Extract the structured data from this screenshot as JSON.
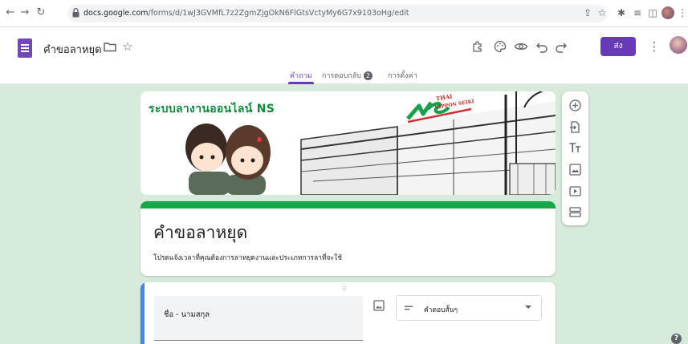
{
  "browser": {
    "url_host": "docs.google.com",
    "url_path": "/forms/d/1wJ3GVMfL7z2ZgmZjgOkN6FlGtsVctyMy6G7x9103oHg/edit"
  },
  "forms_header": {
    "doc_title": "คำขอลาหยุด",
    "send_label": "ส่ง"
  },
  "tabs": {
    "items": [
      {
        "label": "คำถาม",
        "active": true
      },
      {
        "label": "การตอบกลับ",
        "badge": "2"
      },
      {
        "label": "การตั้งค่า"
      }
    ]
  },
  "banner": {
    "title": "ระบบลางานออนไลน์ NS",
    "logo_line1": "THAI",
    "logo_line2": "NIPPON SEIKI"
  },
  "form": {
    "title": "คำขอลาหยุด",
    "description": "โปรดแจ้งเวลาที่คุณต้องการลาหยุดงานและประเภทการลาที่จะใช้"
  },
  "question": {
    "text": "ชื่อ - นามสกุล",
    "type_label": "คำตอบสั้นๆ"
  },
  "colors": {
    "theme_accent": "#14a84a",
    "page_background": "#d6ebdc",
    "brand_purple": "#673ab7",
    "question_accent": "#4285f4"
  },
  "icons": {
    "side_toolbar": [
      "add-question-icon",
      "import-questions-icon",
      "add-title-icon",
      "add-image-icon",
      "add-video-icon",
      "add-section-icon"
    ],
    "header": [
      "addon-icon",
      "palette-icon",
      "preview-icon",
      "undo-icon",
      "redo-icon",
      "more-icon"
    ]
  }
}
